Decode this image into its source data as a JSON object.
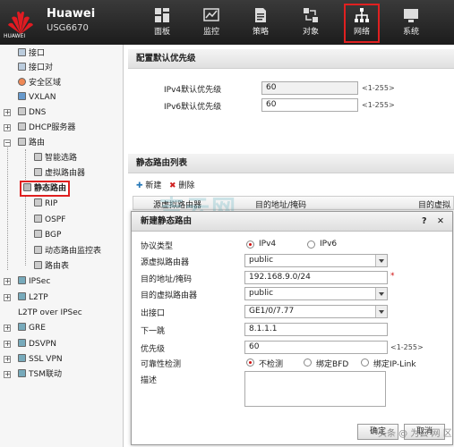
{
  "header": {
    "brand": "Huawei",
    "model": "USG6670",
    "logo_text": "HUAWEI",
    "nav": [
      {
        "label": "面板",
        "icon": "dashboard-icon"
      },
      {
        "label": "监控",
        "icon": "monitor-icon"
      },
      {
        "label": "策略",
        "icon": "policy-icon"
      },
      {
        "label": "对象",
        "icon": "object-icon"
      },
      {
        "label": "网络",
        "icon": "network-icon",
        "active": true
      },
      {
        "label": "系统",
        "icon": "system-icon"
      }
    ]
  },
  "sidebar": {
    "items": [
      {
        "label": "接口"
      },
      {
        "label": "接口对"
      },
      {
        "label": "安全区域"
      },
      {
        "label": "VXLAN"
      },
      {
        "label": "DNS"
      },
      {
        "label": "DHCP服务器"
      },
      {
        "label": "路由"
      },
      {
        "label": "智能选路"
      },
      {
        "label": "虚拟路由器"
      },
      {
        "label": "静态路由",
        "selected": true
      },
      {
        "label": "RIP"
      },
      {
        "label": "OSPF"
      },
      {
        "label": "BGP"
      },
      {
        "label": "动态路由监控表"
      },
      {
        "label": "路由表"
      },
      {
        "label": "IPSec"
      },
      {
        "label": "L2TP"
      },
      {
        "label": "L2TP over IPSec"
      },
      {
        "label": "GRE"
      },
      {
        "label": "DSVPN"
      },
      {
        "label": "SSL VPN"
      },
      {
        "label": "TSM联动"
      }
    ]
  },
  "priority": {
    "title": "配置默认优先级",
    "ipv4_label": "IPv4默认优先级",
    "ipv4_value": "60",
    "ipv6_label": "IPv6默认优先级",
    "ipv6_value": "60",
    "range_hint": "<1-255>"
  },
  "route_list": {
    "title": "静态路由列表",
    "new_label": "新建",
    "delete_label": "删除",
    "columns": [
      "源虚拟路由器",
      "目的地址/掩码",
      "目的虚拟路"
    ]
  },
  "dialog": {
    "title": "新建静态路由",
    "help": "?",
    "close": "✕",
    "protocol_label": "协议类型",
    "protocol_options": [
      "IPv4",
      "IPv6"
    ],
    "protocol_selected": "IPv4",
    "src_vr_label": "源虚拟路由器",
    "src_vr_value": "public",
    "dest_label": "目的地址/掩码",
    "dest_value": "192.168.9.0/24",
    "required_mark": "*",
    "dest_vr_label": "目的虚拟路由器",
    "dest_vr_value": "public",
    "out_if_label": "出接口",
    "out_if_value": "GE1/0/7.77",
    "next_hop_label": "下一跳",
    "next_hop_value": "8.1.1.1",
    "priority_label": "优先级",
    "priority_value": "60",
    "priority_hint": "<1-255>",
    "reliability_label": "可靠性检测",
    "reliability_options": [
      "不检测",
      "绑定BFD",
      "绑定IP-Link"
    ],
    "reliability_selected": "不检测",
    "desc_label": "描述",
    "ok_label": "确定",
    "cancel_label": "取消"
  },
  "watermark": "吉云网",
  "footer_mark": "头条 @ 为云 网 区",
  "colors": {
    "highlight": "#e02020",
    "header_bg": "#2a2a2a"
  }
}
